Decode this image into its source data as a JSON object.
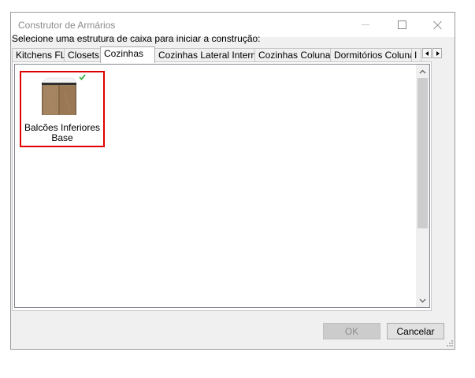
{
  "window": {
    "title": "Construtor de Armários"
  },
  "instruction": "Selecione uma estrutura de caixa para iniciar a construção:",
  "tabs": [
    {
      "label": "Kitchens FL",
      "active": false
    },
    {
      "label": "Closets",
      "active": false
    },
    {
      "label": "Cozinhas",
      "active": true
    },
    {
      "label": "Cozinhas Lateral Interna",
      "active": false
    },
    {
      "label": "Cozinhas Colunas",
      "active": false
    },
    {
      "label": "Dormitórios Colunas",
      "active": false
    },
    {
      "label": "I",
      "active": false
    }
  ],
  "items": [
    {
      "label": "Balcões Inferiores Base",
      "icon": "base-cabinet-icon",
      "selected": true,
      "checked": true
    }
  ],
  "buttons": {
    "ok_label": "OK",
    "cancel_label": "Cancelar"
  },
  "colors": {
    "selection_border": "#e00000",
    "check": "#3cb043",
    "cabinet_wood": "#9e7d5c"
  }
}
